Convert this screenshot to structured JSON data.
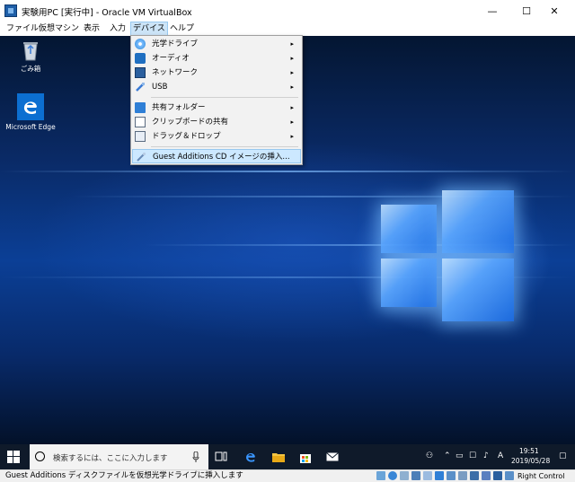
{
  "window": {
    "title": "実験用PC [実行中] - Oracle VM VirtualBox",
    "controls": {
      "minimize": "—",
      "maximize": "☐",
      "close": "✕"
    }
  },
  "menubar": [
    "ファイル",
    "仮想マシン",
    "表示",
    "入力",
    "デバイス",
    "ヘルプ"
  ],
  "devices_menu": {
    "items": [
      {
        "label": "光学ドライブ",
        "icon": "optical-drive-icon",
        "submenu": true
      },
      {
        "label": "オーディオ",
        "icon": "audio-icon",
        "submenu": true
      },
      {
        "label": "ネットワーク",
        "icon": "network-icon",
        "submenu": true
      },
      {
        "label": "USB",
        "icon": "usb-icon",
        "submenu": true
      },
      {
        "label": "共有フォルダー",
        "icon": "shared-folder-icon",
        "submenu": true
      },
      {
        "label": "クリップボードの共有",
        "icon": "clipboard-icon",
        "submenu": true
      },
      {
        "label": "ドラッグ＆ドロップ",
        "icon": "drag-drop-icon",
        "submenu": true
      },
      {
        "label": "Guest Additions CD イメージの挿入...",
        "icon": "guest-additions-icon",
        "submenu": false
      }
    ],
    "highlighted": "Guest Additions CD イメージの挿入...",
    "arrow": "▸"
  },
  "desktop": {
    "icons": [
      {
        "label": "ごみ箱",
        "icon": "recycle-bin-icon"
      },
      {
        "label": "Microsoft Edge",
        "icon": "edge-icon"
      }
    ]
  },
  "taskbar": {
    "search_placeholder": "検索するには、ここに入力します",
    "ime_indicator": "A",
    "clock_time": "19:51",
    "clock_date": "2019/05/28",
    "pinned": [
      "task-view-icon",
      "edge-icon",
      "file-explorer-icon",
      "store-icon",
      "mail-icon"
    ]
  },
  "statusbar": {
    "message": "Guest Additions ディスクファイルを仮想光学ドライブに挿入します",
    "host_key": "Right Control"
  },
  "colors": {
    "accent_highlight": "#cce8ff",
    "taskbar": "#0f1a2a",
    "desktop_blue": "#0b3f96"
  }
}
